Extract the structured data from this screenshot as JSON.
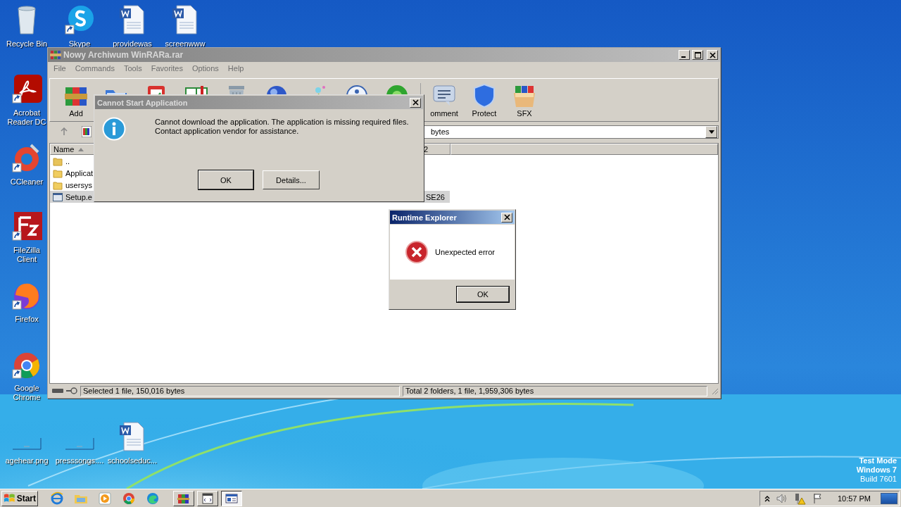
{
  "desktop_icons": [
    {
      "label": "Recycle Bin",
      "kind": "recycle",
      "shortcut": false
    },
    {
      "label": "Skype",
      "kind": "skype",
      "shortcut": true
    },
    {
      "label": "providewas",
      "kind": "word",
      "shortcut": false
    },
    {
      "label": "screenwww",
      "kind": "word",
      "shortcut": false
    },
    {
      "label": "Acrobat Reader DC",
      "kind": "acrobat",
      "shortcut": true
    },
    {
      "label": "CCleaner",
      "kind": "ccleaner",
      "shortcut": true
    },
    {
      "label": "FileZilla Client",
      "kind": "filezilla",
      "shortcut": true
    },
    {
      "label": "Firefox",
      "kind": "firefox",
      "shortcut": true
    },
    {
      "label": "Google Chrome",
      "kind": "chrome",
      "shortcut": true
    },
    {
      "label": "agehear.png",
      "kind": "blank",
      "shortcut": false
    },
    {
      "label": "presssongs....",
      "kind": "blank",
      "shortcut": false
    },
    {
      "label": "schoolseduc...",
      "kind": "word",
      "shortcut": false
    }
  ],
  "os_notice": [
    "Test Mode",
    "Windows 7",
    "Build 7601"
  ],
  "winrar": {
    "title": "Nowy Archiwum WinRARa.rar",
    "active": false,
    "menu": [
      "File",
      "Commands",
      "Tools",
      "Favorites",
      "Options",
      "Help"
    ],
    "toolbar": [
      {
        "kind": "add",
        "label": "Add"
      },
      {
        "kind": "extract"
      },
      {
        "kind": "test"
      },
      {
        "kind": "view"
      },
      {
        "kind": "delete"
      },
      {
        "kind": "find"
      },
      {
        "kind": "wizard"
      },
      {
        "kind": "info"
      },
      {
        "kind": "scan"
      },
      {
        "kind": "comment",
        "label": "omment"
      },
      {
        "kind": "protect",
        "label": "Protect"
      },
      {
        "kind": "sfx",
        "label": "SFX"
      }
    ],
    "address": "bytes",
    "columns": [
      "Name",
      "2"
    ],
    "files": [
      {
        "kind": "parent",
        "name": "..",
        "selected": false
      },
      {
        "kind": "folder",
        "name": "Applicat",
        "selected": false
      },
      {
        "kind": "folder",
        "name": "usersys",
        "selected": false
      },
      {
        "kind": "exe",
        "name": "Setup.e",
        "column_2": "SE26",
        "selected": true
      }
    ],
    "status": [
      "Selected 1 file, 150,016 bytes",
      "Total 2 folders, 1 file, 1,959,306 bytes"
    ]
  },
  "dialogs": [
    {
      "kind": "info",
      "title": "Cannot Start Application",
      "active": false,
      "message": "Cannot download the application. The application is missing required files.\nContact application vendor for assistance.",
      "buttons": [
        {
          "label": "OK",
          "default": true
        },
        {
          "label": "Details...",
          "default": false
        }
      ]
    },
    {
      "kind": "error",
      "title": "Runtime Explorer",
      "active": true,
      "message": "Unexpected error",
      "buttons": [
        {
          "label": "OK",
          "default": true
        }
      ]
    }
  ],
  "taskbar": {
    "start": "Start",
    "launchers": [
      {
        "kind": "ie"
      },
      {
        "kind": "explorer"
      },
      {
        "kind": "media"
      },
      {
        "kind": "chrome"
      },
      {
        "kind": "edge"
      }
    ],
    "windows": [
      {
        "kind": "winrar",
        "selected": false
      },
      {
        "kind": "app",
        "selected": false
      },
      {
        "kind": "dialog",
        "selected": true
      }
    ],
    "time": "10:57 PM"
  }
}
